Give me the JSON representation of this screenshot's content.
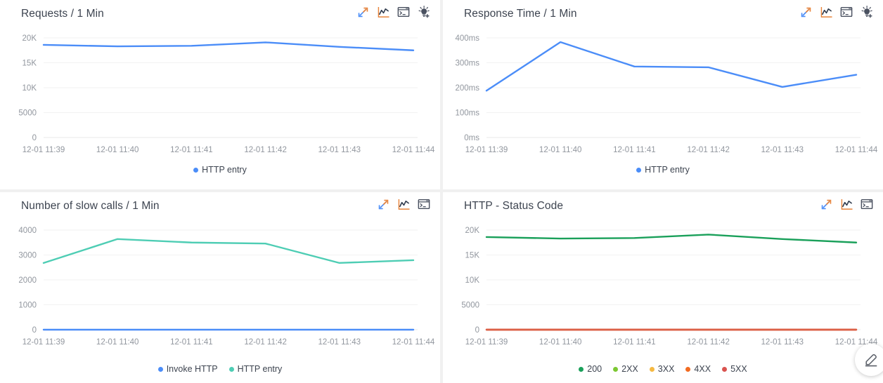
{
  "meta": {
    "background": "#f0f0f0",
    "panel_background": "#ffffff",
    "title_color": "#3d4450",
    "axis_label_color": "#91969e",
    "gridline_color": "#f2f2f2"
  },
  "colors": {
    "blue": "#4b8df8",
    "teal": "#4ecdb4",
    "green_200": "#1aa05a",
    "green_2xx": "#7cc832",
    "amber_3xx": "#f5b942",
    "orange_4xx": "#f26b21",
    "red_5xx": "#d9534f",
    "red_line": "#dc6047"
  },
  "tools": {
    "expand": {
      "label": "Expand",
      "icon": "expand-arrows-icon"
    },
    "chart": {
      "label": "Chart",
      "icon": "line-chart-icon"
    },
    "console": {
      "label": "Console",
      "icon": "terminal-icon"
    },
    "insight": {
      "label": "Insight",
      "icon": "lightbulb-plus-icon"
    }
  },
  "fab": {
    "label": "Edit",
    "icon": "pencil-edit-icon"
  },
  "panels": [
    {
      "id": "requests",
      "title": "Requests / 1 Min",
      "tools": [
        "expand",
        "chart",
        "console",
        "insight"
      ],
      "legend": [
        {
          "label": "HTTP entry",
          "color": "#4b8df8"
        }
      ]
    },
    {
      "id": "response-time",
      "title": "Response Time / 1 Min",
      "tools": [
        "expand",
        "chart",
        "console",
        "insight"
      ],
      "legend": [
        {
          "label": "HTTP entry",
          "color": "#4b8df8"
        }
      ]
    },
    {
      "id": "slow-calls",
      "title": "Number of slow calls / 1 Min",
      "tools": [
        "expand",
        "chart",
        "console"
      ],
      "legend": [
        {
          "label": "Invoke HTTP",
          "color": "#4b8df8"
        },
        {
          "label": "HTTP entry",
          "color": "#4ecdb4"
        }
      ]
    },
    {
      "id": "status-code",
      "title": "HTTP - Status Code",
      "tools": [
        "expand",
        "chart",
        "console"
      ],
      "legend": [
        {
          "label": "200",
          "color": "#1aa05a"
        },
        {
          "label": "2XX",
          "color": "#7cc832"
        },
        {
          "label": "3XX",
          "color": "#f5b942"
        },
        {
          "label": "4XX",
          "color": "#f26b21"
        },
        {
          "label": "5XX",
          "color": "#d9534f"
        }
      ]
    }
  ],
  "chart_data": [
    {
      "id": "requests",
      "type": "line",
      "title": "Requests / 1 Min",
      "xlabel": "",
      "ylabel": "",
      "grid": true,
      "legend_position": "bottom",
      "x": [
        "12-01 11:39",
        "12-01 11:40",
        "12-01 11:41",
        "12-01 11:42",
        "12-01 11:43",
        "12-01 11:44"
      ],
      "ytick_labels": [
        "20K",
        "15K",
        "10K",
        "5000",
        "0"
      ],
      "ytick_values": [
        20000,
        15000,
        10000,
        5000,
        0
      ],
      "ylim": [
        0,
        20000
      ],
      "series": [
        {
          "name": "HTTP entry",
          "color": "#4b8df8",
          "values": [
            18600,
            18300,
            18400,
            19100,
            18200,
            17500
          ]
        }
      ]
    },
    {
      "id": "response-time",
      "type": "line",
      "title": "Response Time / 1 Min",
      "xlabel": "",
      "ylabel": "",
      "grid": true,
      "legend_position": "bottom",
      "x": [
        "12-01 11:39",
        "12-01 11:40",
        "12-01 11:41",
        "12-01 11:42",
        "12-01 11:43",
        "12-01 11:44"
      ],
      "ytick_labels": [
        "400ms",
        "300ms",
        "200ms",
        "100ms",
        "0ms"
      ],
      "ytick_values": [
        400,
        300,
        200,
        100,
        0
      ],
      "ylim": [
        0,
        400
      ],
      "series": [
        {
          "name": "HTTP entry",
          "color": "#4b8df8",
          "values": [
            188,
            383,
            285,
            282,
            203,
            252
          ]
        }
      ]
    },
    {
      "id": "slow-calls",
      "type": "line",
      "title": "Number of slow calls / 1 Min",
      "xlabel": "",
      "ylabel": "",
      "grid": true,
      "legend_position": "bottom",
      "x": [
        "12-01 11:39",
        "12-01 11:40",
        "12-01 11:41",
        "12-01 11:42",
        "12-01 11:43",
        "12-01 11:44"
      ],
      "ytick_labels": [
        "4000",
        "3000",
        "2000",
        "1000",
        "0"
      ],
      "ytick_values": [
        4000,
        3000,
        2000,
        1000,
        0
      ],
      "ylim": [
        0,
        4000
      ],
      "series": [
        {
          "name": "Invoke HTTP",
          "color": "#4b8df8",
          "values": [
            0,
            0,
            0,
            0,
            0,
            0
          ]
        },
        {
          "name": "HTTP entry",
          "color": "#4ecdb4",
          "values": [
            2680,
            3640,
            3500,
            3460,
            2680,
            2790
          ]
        }
      ]
    },
    {
      "id": "status-code",
      "type": "line",
      "title": "HTTP - Status Code",
      "xlabel": "",
      "ylabel": "",
      "grid": true,
      "legend_position": "bottom",
      "x": [
        "12-01 11:39",
        "12-01 11:40",
        "12-01 11:41",
        "12-01 11:42",
        "12-01 11:43",
        "12-01 11:44"
      ],
      "ytick_labels": [
        "20K",
        "15K",
        "10K",
        "5000",
        "0"
      ],
      "ytick_values": [
        20000,
        15000,
        10000,
        5000,
        0
      ],
      "ylim": [
        0,
        20000
      ],
      "series": [
        {
          "name": "200",
          "color": "#1aa05a",
          "values": [
            18600,
            18300,
            18400,
            19100,
            18200,
            17500
          ]
        },
        {
          "name": "2XX",
          "color": "#7cc832",
          "values": [
            0,
            0,
            0,
            0,
            0,
            0
          ]
        },
        {
          "name": "3XX",
          "color": "#f5b942",
          "values": [
            0,
            0,
            0,
            0,
            0,
            0
          ]
        },
        {
          "name": "4XX",
          "color": "#f26b21",
          "values": [
            0,
            0,
            0,
            0,
            0,
            0
          ]
        },
        {
          "name": "5XX",
          "color": "#d9534f",
          "values": [
            0,
            0,
            0,
            0,
            0,
            0
          ]
        }
      ]
    }
  ]
}
